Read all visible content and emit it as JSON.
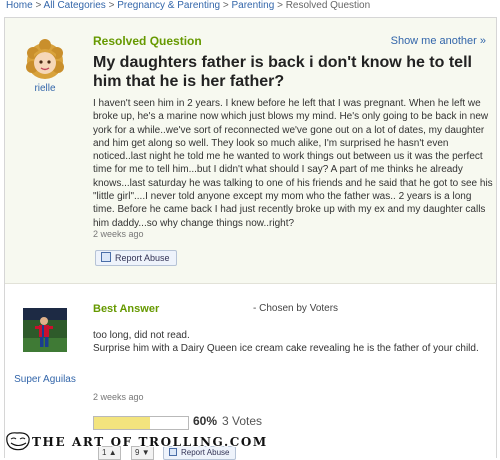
{
  "breadcrumb": {
    "items": [
      "Home",
      "All Categories",
      "Pregnancy & Parenting",
      "Parenting",
      "Resolved Question"
    ],
    "separator": ">"
  },
  "question": {
    "section_label": "Resolved Question",
    "show_more": "Show me another »",
    "asker": "rielle",
    "title": "My daughters father is back i don't know he to tell him that he is her father?",
    "body": "I haven't seen him in 2 years. I knew before he left that I was pregnant. When he left we broke up, he's a marine now which just blows my mind. He's only going to be back in new york for a while..we've sort of reconnected we've gone out on a lot of dates, my daughter and him get along so well. They look so much alike, I'm surprised he hasn't even noticed..last night he told me he wanted to work things out between us it was the perfect time for me to tell him...but I didn't what should I say? A part of me thinks he already knows...last saturday he was talking to one of his friends and he said that he got to see his \"little girl\"....I never told anyone except my mom who the father was.. 2 years is a long time. Before he came back I had just recently broke up with my ex and my daughter calls him daddy...so why change things now..right?",
    "timestamp": "2 weeks ago",
    "report_label": "Report Abuse"
  },
  "answer": {
    "section_label": "Best Answer",
    "chosen_by": "- Chosen by Voters",
    "answerer": "Super Aguilas",
    "body_line1": "too long, did not read.",
    "body_line2": "Surprise him with a Dairy Queen ice cream cake revealing he is the father of your child.",
    "timestamp": "2 weeks ago",
    "vote_percent": "60%",
    "vote_fraction": 0.6,
    "vote_count": "3 Votes",
    "thumbs_up": "1",
    "thumbs_down": "9",
    "report_label": "Report Abuse"
  },
  "watermark": "THE ART OF TROLLING.COM",
  "colors": {
    "section_green": "#669900",
    "link_blue": "#3366aa",
    "question_bg": "#f7f9f0",
    "vote_fill": "#f3e47e"
  },
  "icons": [
    "chevron-right-icon",
    "report-flag-icon",
    "thumbs-up-icon",
    "thumbs-down-icon",
    "troll-face-icon"
  ]
}
